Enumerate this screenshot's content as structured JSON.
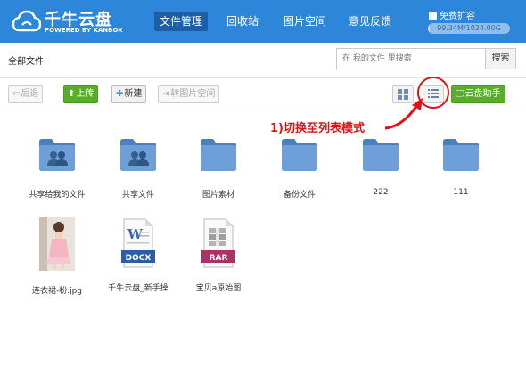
{
  "app": {
    "title": "千牛云盘",
    "subtitle": "POWERED BY KANBOX"
  },
  "nav": {
    "tabs": [
      {
        "label": "文件管理",
        "active": true
      },
      {
        "label": "回收站",
        "active": false
      },
      {
        "label": "图片空间",
        "active": false
      },
      {
        "label": "意见反馈",
        "active": false
      }
    ]
  },
  "account": {
    "upgrade_label": "免费扩容",
    "quota_text": "99.34M/1024.00G",
    "quota_used_fraction": 0.0001
  },
  "breadcrumb": {
    "label": "全部文件"
  },
  "search": {
    "placeholder": "在 我的文件 里搜索",
    "button_label": "搜索"
  },
  "toolbar": {
    "back_label": "后退",
    "upload_label": "上传",
    "new_label": "新建",
    "move_to_image_space_label": "转图片空间",
    "assistant_label": "云盘助手"
  },
  "annotation": {
    "text": "1)切换至列表模式"
  },
  "files": [
    {
      "name": "共享给我的文件",
      "type": "shared-folder"
    },
    {
      "name": "共享文件",
      "type": "shared-folder"
    },
    {
      "name": "图片素材",
      "type": "folder"
    },
    {
      "name": "备份文件",
      "type": "folder"
    },
    {
      "name": "222",
      "type": "folder"
    },
    {
      "name": "111",
      "type": "folder"
    },
    {
      "name": "连衣裙-粉.jpg",
      "type": "image"
    },
    {
      "name": "千牛云盘_新手操",
      "type": "docx",
      "badge": "DOCX"
    },
    {
      "name": "宝贝a原始图",
      "type": "rar",
      "badge": "RAR"
    }
  ],
  "colors": {
    "header": "#2d86d9",
    "accent_green": "#5aad2a",
    "annotation_red": "#e01313",
    "folder_blue": "#5a8fd0"
  }
}
